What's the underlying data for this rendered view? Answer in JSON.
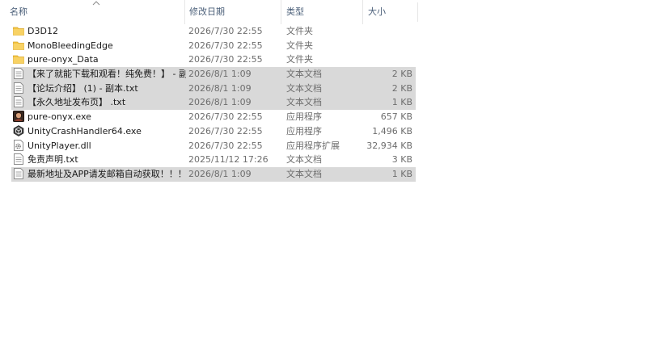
{
  "columns": {
    "name": "名称",
    "date": "修改日期",
    "type": "类型",
    "size": "大小"
  },
  "sort": {
    "column": "name",
    "direction": "ascending"
  },
  "colors": {
    "folder": "#f5c542",
    "selection": "#d9d9d9",
    "header_text": "#4c607a"
  },
  "files": [
    {
      "name": "D3D12",
      "date": "2026/7/30 22:55",
      "type": "文件夹",
      "size": "",
      "icon": "folder-icon",
      "selected": false
    },
    {
      "name": "MonoBleedingEdge",
      "date": "2026/7/30 22:55",
      "type": "文件夹",
      "size": "",
      "icon": "folder-icon",
      "selected": false
    },
    {
      "name": "pure-onyx_Data",
      "date": "2026/7/30 22:55",
      "type": "文件夹",
      "size": "",
      "icon": "folder-icon",
      "selected": false
    },
    {
      "name": "【来了就能下载和观看！纯免费！】 - 副...",
      "date": "2026/8/1 1:09",
      "type": "文本文档",
      "size": "2 KB",
      "icon": "text-file-icon",
      "selected": true
    },
    {
      "name": "【论坛介绍】 (1) - 副本.txt",
      "date": "2026/8/1 1:09",
      "type": "文本文档",
      "size": "2 KB",
      "icon": "text-file-icon",
      "selected": true
    },
    {
      "name": "【永久地址发布页】 .txt",
      "date": "2026/8/1 1:09",
      "type": "文本文档",
      "size": "1 KB",
      "icon": "text-file-icon",
      "selected": true
    },
    {
      "name": "pure-onyx.exe",
      "date": "2026/7/30 22:55",
      "type": "应用程序",
      "size": "657 KB",
      "icon": "app-exe-icon",
      "selected": false
    },
    {
      "name": "UnityCrashHandler64.exe",
      "date": "2026/7/30 22:55",
      "type": "应用程序",
      "size": "1,496 KB",
      "icon": "unity-icon",
      "selected": false
    },
    {
      "name": "UnityPlayer.dll",
      "date": "2026/7/30 22:55",
      "type": "应用程序扩展",
      "size": "32,934 KB",
      "icon": "dll-icon",
      "selected": false
    },
    {
      "name": "免责声明.txt",
      "date": "2025/11/12 17:26",
      "type": "文本文档",
      "size": "3 KB",
      "icon": "text-file-icon",
      "selected": false
    },
    {
      "name": "最新地址及APP请发邮箱自动获取！！！...",
      "date": "2026/8/1 1:09",
      "type": "文本文档",
      "size": "1 KB",
      "icon": "text-file-icon",
      "selected": true
    }
  ]
}
